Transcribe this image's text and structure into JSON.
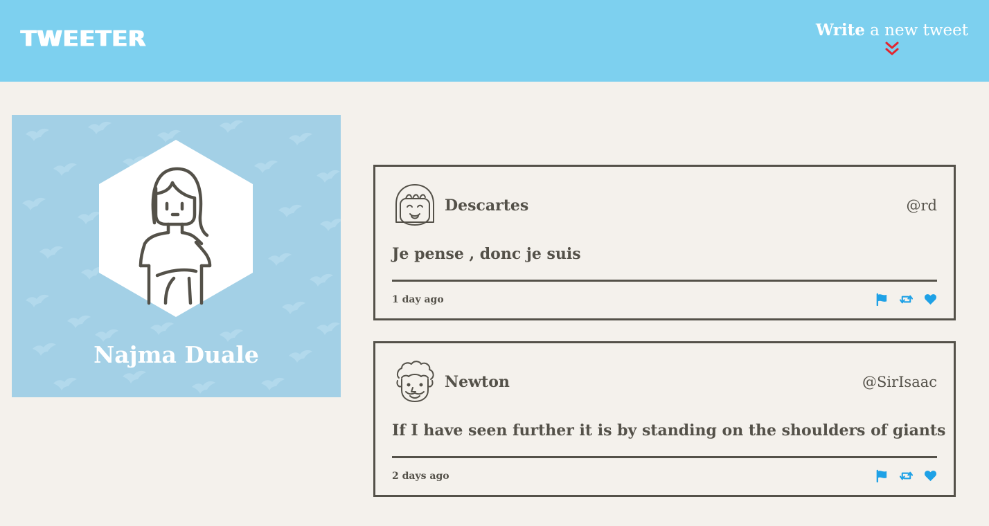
{
  "header": {
    "logo": "TWEETER",
    "compose_strong": "Write",
    "compose_rest": "a new tweet",
    "compose_icon": "double-chevron-down-icon",
    "compose_icon_color": "#e3252f",
    "background": "#7dd0ef"
  },
  "profile": {
    "name": "Najma Duale",
    "avatar_icon": "woman-avatar-icon",
    "background": "#a3d0e6"
  },
  "tweets": [
    {
      "name": "Descartes",
      "handle": "@rd",
      "text": "Je pense , donc je suis",
      "time": "1 day ago",
      "avatar_icon": "girl-with-bangs-avatar-icon"
    },
    {
      "name": "Newton",
      "handle": "@SirIsaac",
      "text": "If I have seen further it is by standing on the shoulders of giants",
      "time": "2 days ago",
      "avatar_icon": "curly-haired-man-avatar-icon"
    }
  ],
  "actions": {
    "icons": [
      "flag-icon",
      "retweet-icon",
      "heart-icon"
    ],
    "color": "#1ea1e6"
  },
  "colors": {
    "page_background": "#f4f1ec",
    "text": "#545149"
  }
}
